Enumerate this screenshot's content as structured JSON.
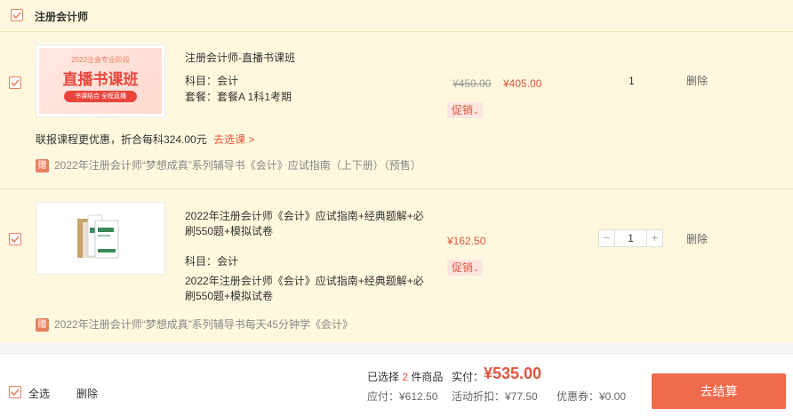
{
  "shop": {
    "title": "注册会计师"
  },
  "items": [
    {
      "thumb": {
        "top_text": "2022注会专业阶段",
        "main_text": "直播书课班",
        "pill_text": "书课结合 全程直播"
      },
      "name": "注册会计师-直播书课班",
      "subject": "科目：会计",
      "package": "套餐：套餐A 1科1考期",
      "old_price": "¥450.00",
      "price": "¥405.00",
      "promo": "促销",
      "qty": "1",
      "delete": "删除",
      "bundle_text": "联报课程更优惠，折合每科324.00元",
      "bundle_link": "去选课 >",
      "gift_badge": "赠",
      "gift": "2022年注册会计师“梦想成真”系列辅导书《会计》应试指南（上下册）（预售）"
    },
    {
      "name": "2022年注册会计师《会计》应试指南+经典题解+必刷550题+模拟试卷",
      "subject": "科目：会计",
      "package": "2022年注册会计师《会计》应试指南+经典题解+必刷550题+模拟试卷",
      "price": "¥162.50",
      "promo": "促销",
      "qty": "1",
      "minus": "−",
      "plus": "+",
      "delete": "删除",
      "gift_badge": "赠",
      "gift": "2022年注册会计师“梦想成真”系列辅导书每天45分钟学《会计》"
    }
  ],
  "footer": {
    "select_all": "全选",
    "delete": "删除",
    "selected_prefix": "已选择",
    "selected_count": "2",
    "selected_suffix": "件商品",
    "actual_label": "实付：",
    "actual_value": "¥535.00",
    "payable": "应付：¥612.50",
    "discount": "活动折扣：¥77.50",
    "coupon": "优惠券：¥0.00",
    "checkout": "去结算"
  },
  "colors": {
    "accent": "#f06a4d",
    "price": "#e1553e",
    "row_bg": "#fff8de"
  }
}
